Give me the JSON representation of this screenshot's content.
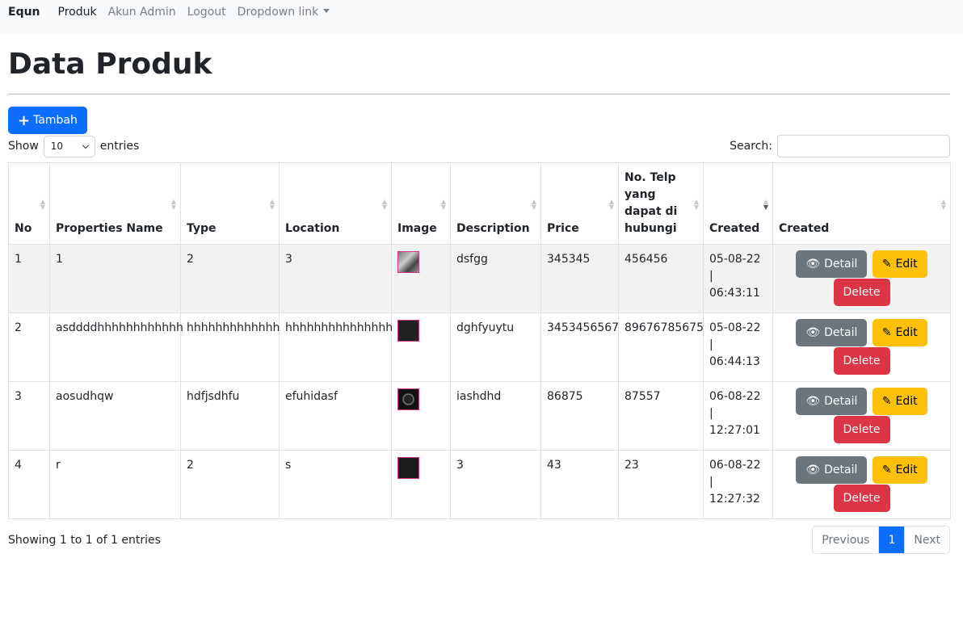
{
  "navbar": {
    "brand": "Equn",
    "links": [
      "Produk",
      "Akun Admin",
      "Logout",
      "Dropdown link"
    ]
  },
  "page": {
    "title": "Data Produk"
  },
  "toolbar": {
    "add_label": "Tambah"
  },
  "length_control": {
    "prefix": "Show",
    "value": "10",
    "suffix": "entries"
  },
  "search": {
    "label": "Search:",
    "value": ""
  },
  "table": {
    "headers": [
      "No",
      "Properties Name",
      "Type",
      "Location",
      "Image",
      "Description",
      "Price",
      "No. Telp yang dapat di hubungi",
      "Created",
      "Created"
    ],
    "rows": [
      {
        "no": "1",
        "name": "1",
        "type": "2",
        "location": "3",
        "description": "dsfgg",
        "price": "345345",
        "phone": "456456",
        "created": "05-08-22 | 06:43:11"
      },
      {
        "no": "2",
        "name": "asddddhhhhhhhhhhhh",
        "type": "hhhhhhhhhhhhh",
        "location": "hhhhhhhhhhhhhhh",
        "description": "dghfyuytu",
        "price": "3453456567",
        "phone": "89676785675",
        "created": "05-08-22 | 06:44:13"
      },
      {
        "no": "3",
        "name": "aosudhqw",
        "type": "hdfjsdhfu",
        "location": "efuhidasf",
        "description": "iashdhd",
        "price": "86875",
        "phone": "87557",
        "created": "06-08-22 | 12:27:01"
      },
      {
        "no": "4",
        "name": "r",
        "type": "2",
        "location": "s",
        "description": "3",
        "price": "43",
        "phone": "23",
        "created": "06-08-22 | 12:27:32"
      }
    ],
    "actions": {
      "detail": "Detail",
      "edit": "Edit",
      "delete": "Delete"
    }
  },
  "footer": {
    "info": "Showing 1 to 1 of 1 entries",
    "pagination": {
      "previous": "Previous",
      "current": "1",
      "next": "Next"
    }
  },
  "colors": {
    "primary": "#0d6efd",
    "secondary": "#6c757d",
    "warning": "#ffc107",
    "danger": "#dc3545"
  }
}
